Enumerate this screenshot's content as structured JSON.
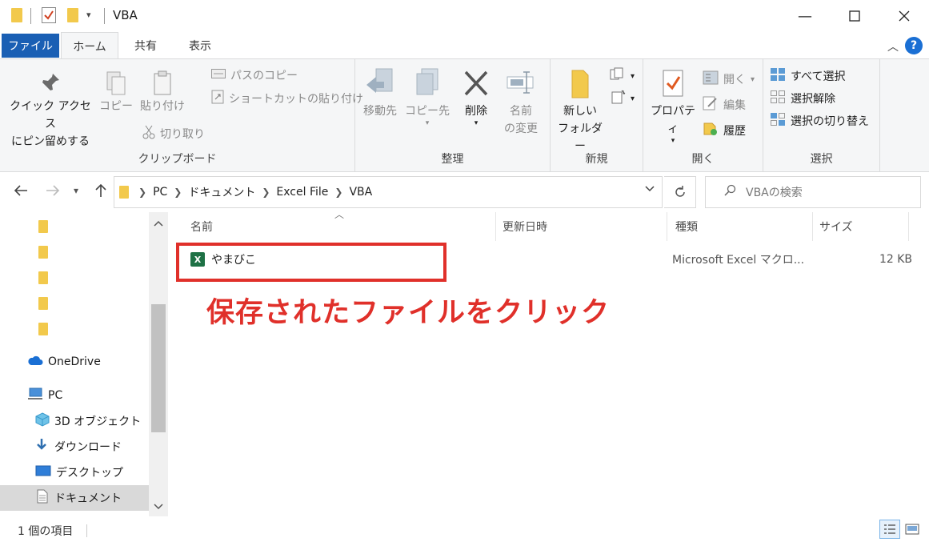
{
  "titlebar": {
    "title": "VBA",
    "qa_icons": [
      "folder-icon",
      "checkmark-properties-icon",
      "new-folder-icon",
      "dropdown-icon"
    ],
    "minimize": "—",
    "maximize": "☐",
    "close": "✕"
  },
  "tabs": {
    "file": "ファイル",
    "home": "ホーム",
    "share": "共有",
    "view": "表示"
  },
  "ribbon": {
    "clipboard": {
      "label": "クリップボード",
      "pin_line1": "クイック アクセス",
      "pin_line2": "にピン留めする",
      "copy": "コピー",
      "paste": "貼り付け",
      "copy_path": "パスのコピー",
      "paste_shortcut": "ショートカットの貼り付け",
      "cut": "切り取り"
    },
    "organize": {
      "label": "整理",
      "move_to": "移動先",
      "copy_to": "コピー先",
      "delete": "削除",
      "rename_line1": "名前",
      "rename_line2": "の変更"
    },
    "new": {
      "label": "新規",
      "new_folder_line1": "新しい",
      "new_folder_line2": "フォルダー"
    },
    "open": {
      "label": "開く",
      "properties": "プロパティ",
      "open": "開く",
      "edit": "編集",
      "history": "履歴"
    },
    "select": {
      "label": "選択",
      "select_all": "すべて選択",
      "select_none": "選択解除",
      "invert": "選択の切り替え"
    }
  },
  "address": {
    "crumbs": [
      "PC",
      "ドキュメント",
      "Excel File",
      "VBA"
    ],
    "search_placeholder": "VBAの検索"
  },
  "navpane": {
    "items": [
      {
        "label": "OneDrive",
        "icon": "cloud-icon"
      },
      {
        "label": "PC",
        "icon": "pc-icon"
      },
      {
        "label": "3D オブジェクト",
        "icon": "3d-objects-icon"
      },
      {
        "label": "ダウンロード",
        "icon": "download-icon"
      },
      {
        "label": "デスクトップ",
        "icon": "desktop-icon"
      },
      {
        "label": "ドキュメント",
        "icon": "documents-icon",
        "selected": true
      }
    ]
  },
  "filelist": {
    "columns": {
      "name": "名前",
      "modified": "更新日時",
      "type": "種類",
      "size": "サイズ"
    },
    "files": [
      {
        "name": "やまびこ",
        "modified": "",
        "type": "Microsoft Excel マクロ...",
        "size": "12 KB",
        "icon": "excel-macro-icon"
      }
    ]
  },
  "annotation": {
    "text": "保存されたファイルをクリック",
    "color": "#e0302a"
  },
  "statusbar": {
    "count": "1 個の項目"
  },
  "colors": {
    "file_tab": "#1a5fb4",
    "ribbon_bg": "#f5f6f7",
    "help": "#1a6fd4",
    "folder": "#f2c94c",
    "excel": "#1e7145"
  }
}
